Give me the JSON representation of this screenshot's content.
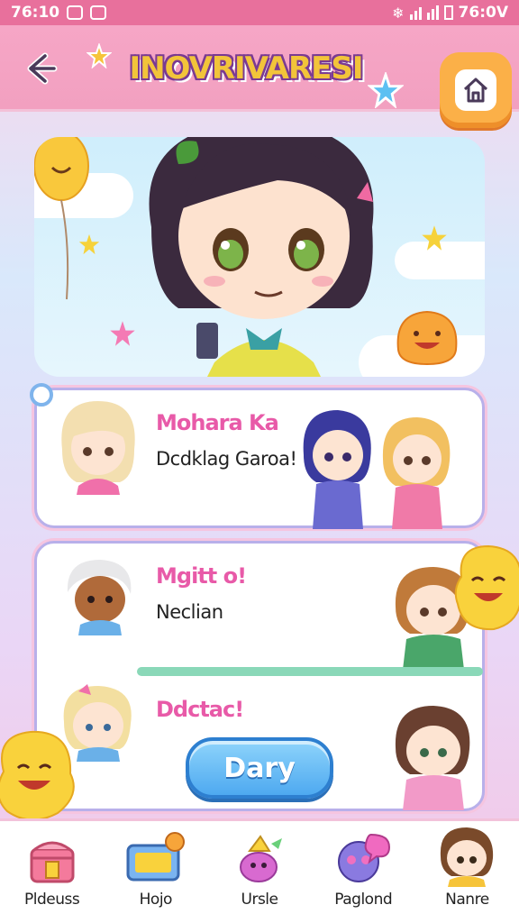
{
  "status_bar": {
    "time_left": "76:10",
    "time_right": "76:0V"
  },
  "header": {
    "title": "INOVRIVARESI"
  },
  "cards": [
    {
      "name": "Mohara Ka",
      "subtitle": "Dcdklag Garoa!"
    },
    {
      "name": "Mgitt  o!",
      "subtitle": "Neclian"
    },
    {
      "name": "Ddctac!"
    }
  ],
  "day_button": {
    "label": "Dary"
  },
  "bottom_nav": [
    {
      "label": "Pldeuss",
      "icon": "treasure-chest-icon"
    },
    {
      "label": "Hojo",
      "icon": "ticket-icon"
    },
    {
      "label": "Ursle",
      "icon": "bird-icon"
    },
    {
      "label": "Paglond",
      "icon": "chat-bubble-icon"
    },
    {
      "label": "Nanre",
      "icon": "avatar-icon"
    }
  ],
  "colors": {
    "accent": "#e8709c",
    "header": "#f6a6c6",
    "button": "#4ea9f0",
    "home": "#fbb048"
  }
}
